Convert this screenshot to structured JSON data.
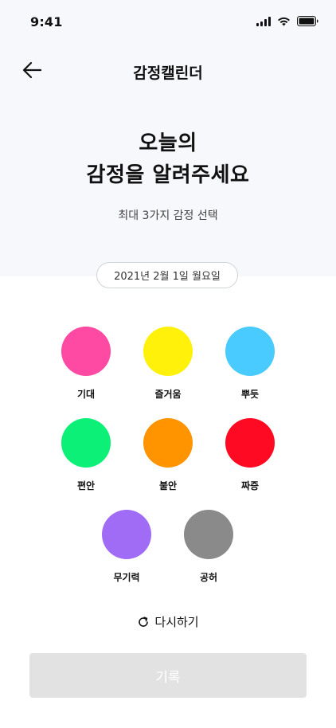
{
  "status_bar": {
    "time": "9:41"
  },
  "header": {
    "title": "감정캘린더"
  },
  "hero": {
    "line1": "오늘의",
    "line2": "감정을 알려주세요",
    "subtitle": "최대 3가지 감정 선택"
  },
  "date": {
    "label": "2021년 2월 1일 월요일"
  },
  "emotions": [
    {
      "label": "기대",
      "color": "#ff4aa3"
    },
    {
      "label": "즐거움",
      "color": "#fff10a"
    },
    {
      "label": "뿌듯",
      "color": "#4acbff"
    },
    {
      "label": "편안",
      "color": "#0df077"
    },
    {
      "label": "불안",
      "color": "#ff9400"
    },
    {
      "label": "짜증",
      "color": "#ff0a22"
    },
    {
      "label": "무기력",
      "color": "#a06cf5"
    },
    {
      "label": "공허",
      "color": "#8a8a8a"
    }
  ],
  "actions": {
    "reset_label": "다시하기",
    "record_label": "기록"
  }
}
